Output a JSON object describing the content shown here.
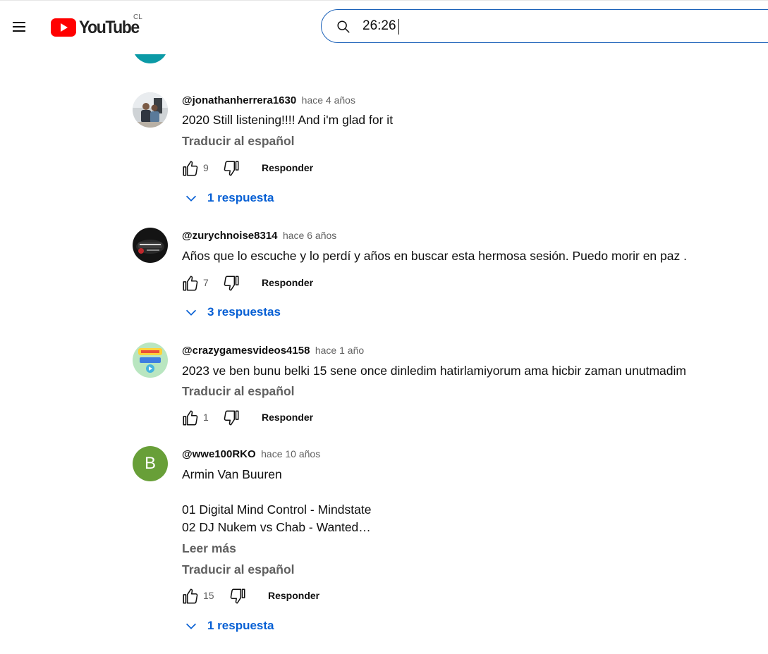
{
  "header": {
    "logo_text": "YouTube",
    "country_code": "CL",
    "search_value": "26:26"
  },
  "comments": [
    {
      "author": "@jonathanherrera1630",
      "time": "hace 4 años",
      "lines": [
        "2020 Still listening!!!! And i'm glad for it"
      ],
      "translate": "Traducir al español",
      "likes": "9",
      "reply_label": "Responder",
      "replies_label": "1 respuesta"
    },
    {
      "author": "@zurychnoise8314",
      "time": "hace 6 años",
      "lines": [
        "Años que lo escuche y lo perdí  y años en buscar esta hermosa sesión. Puedo morir en paz ."
      ],
      "likes": "7",
      "reply_label": "Responder",
      "replies_label": "3 respuestas"
    },
    {
      "author": "@crazygamesvideos4158",
      "time": "hace 1 año",
      "lines": [
        "2023 ve ben bunu belki 15 sene once dinledim hatirlamiyorum ama hicbir zaman unutmadim"
      ],
      "translate": "Traducir al español",
      "likes": "1",
      "reply_label": "Responder"
    },
    {
      "author": "@wwe100RKO",
      "time": "hace 10 años",
      "avatar_letter": "B",
      "lines": [
        "Armin Van Buuren",
        "",
        "01 Digital Mind Control - Mindstate",
        "02 DJ Nukem vs Chab - Wanted…"
      ],
      "read_more": "Leer más",
      "translate": "Traducir al español",
      "likes": "15",
      "reply_label": "Responder",
      "replies_label": "1 respuesta"
    }
  ],
  "colors": {
    "link_blue": "#065fd4",
    "search_border": "#1c62b9",
    "brand_red": "#ff0000",
    "avatar_green": "#689f38",
    "avatar_teal": "#0b9aa6"
  }
}
